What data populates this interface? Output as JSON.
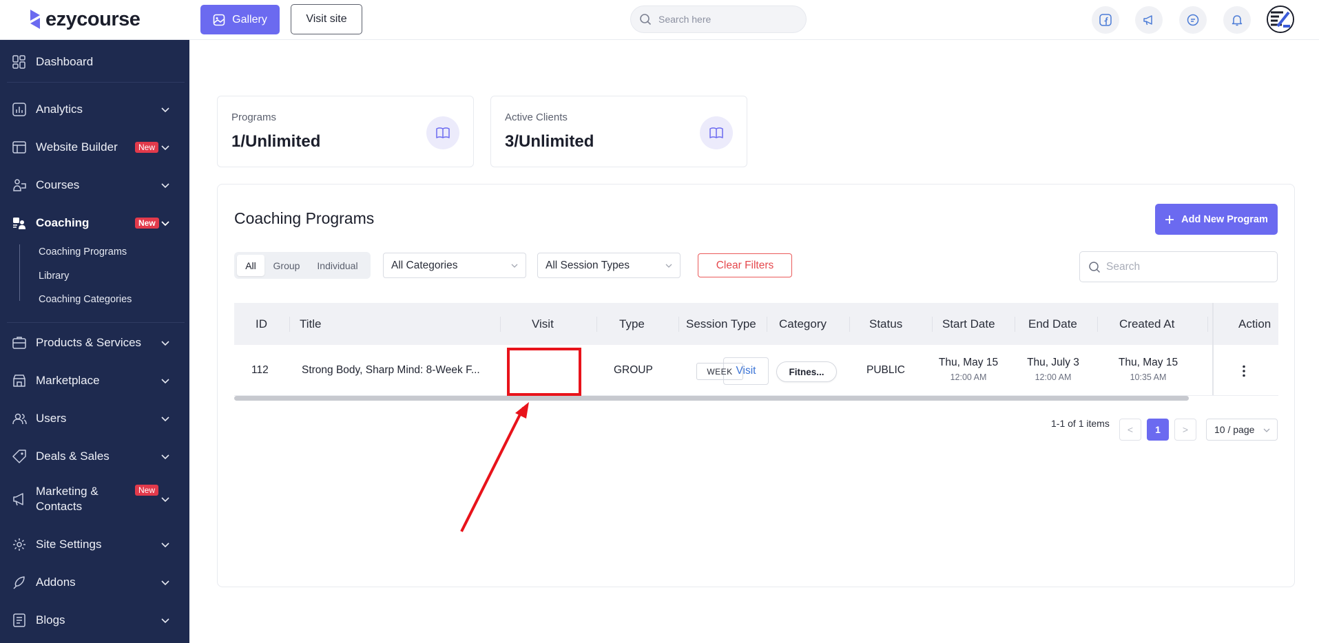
{
  "app": {
    "logo_text": "ezycourse"
  },
  "topbar": {
    "gallery_label": "Gallery",
    "visit_site_label": "Visit site",
    "search_placeholder": "Search here",
    "icons": [
      "facebook-icon",
      "megaphone-icon",
      "chat-icon",
      "bell-icon"
    ]
  },
  "sidebar": {
    "items": [
      {
        "label": "Dashboard",
        "icon": "dashboard-icon"
      },
      {
        "label": "Analytics",
        "icon": "analytics-icon"
      },
      {
        "label": "Website Builder",
        "icon": "website-builder-icon",
        "badge": "New"
      },
      {
        "label": "Courses",
        "icon": "courses-icon"
      },
      {
        "label": "Coaching",
        "icon": "coaching-icon",
        "badge": "New",
        "active": true
      },
      {
        "label": "Products & Services",
        "icon": "products-icon"
      },
      {
        "label": "Marketplace",
        "icon": "marketplace-icon"
      },
      {
        "label": "Users",
        "icon": "users-icon"
      },
      {
        "label": "Deals & Sales",
        "icon": "deals-icon"
      },
      {
        "label": "Marketing & Contacts",
        "label_line1": "Marketing &",
        "label_line2": "Contacts",
        "icon": "marketing-icon",
        "badge": "New"
      },
      {
        "label": "Site Settings",
        "icon": "settings-icon"
      },
      {
        "label": "Addons",
        "icon": "addons-icon"
      },
      {
        "label": "Blogs",
        "icon": "blogs-icon"
      }
    ],
    "coaching_sub": [
      "Coaching Programs",
      "Library",
      "Coaching Categories"
    ]
  },
  "stats": [
    {
      "label": "Programs",
      "value": "1/Unlimited"
    },
    {
      "label": "Active Clients",
      "value": "3/Unlimited"
    }
  ],
  "programs": {
    "title": "Coaching Programs",
    "add_label": "Add New Program",
    "segments": [
      "All",
      "Group",
      "Individual"
    ],
    "selected_segment": "All",
    "category_filter": "All Categories",
    "session_filter": "All Session Types",
    "clear_label": "Clear Filters",
    "search_placeholder": "Search",
    "columns": [
      "ID",
      "Title",
      "Visit",
      "Type",
      "Session Type",
      "Category",
      "Status",
      "Start Date",
      "End Date",
      "Created At",
      "Action"
    ],
    "rows": [
      {
        "id": "112",
        "title": "Strong Body, Sharp Mind: 8-Week F...",
        "visit": "Visit",
        "type": "GROUP",
        "session_type": "WEEK",
        "category": "Fitnes...",
        "status": "PUBLIC",
        "start_date": "Thu, May 15",
        "start_time": "12:00 AM",
        "end_date": "Thu, July 3",
        "end_time": "12:00 AM",
        "created_date": "Thu, May 15",
        "created_time": "10:35 AM"
      }
    ],
    "pagination": {
      "summary": "1-1 of 1 items",
      "prev": "<",
      "current": "1",
      "next": ">",
      "page_size": "10 / page"
    }
  },
  "colors": {
    "accent": "#6b6af0",
    "sidebar_bg": "#1e2a4f",
    "badge": "#e23a4b",
    "danger": "#e5484d",
    "annotation": "#e8131b"
  }
}
